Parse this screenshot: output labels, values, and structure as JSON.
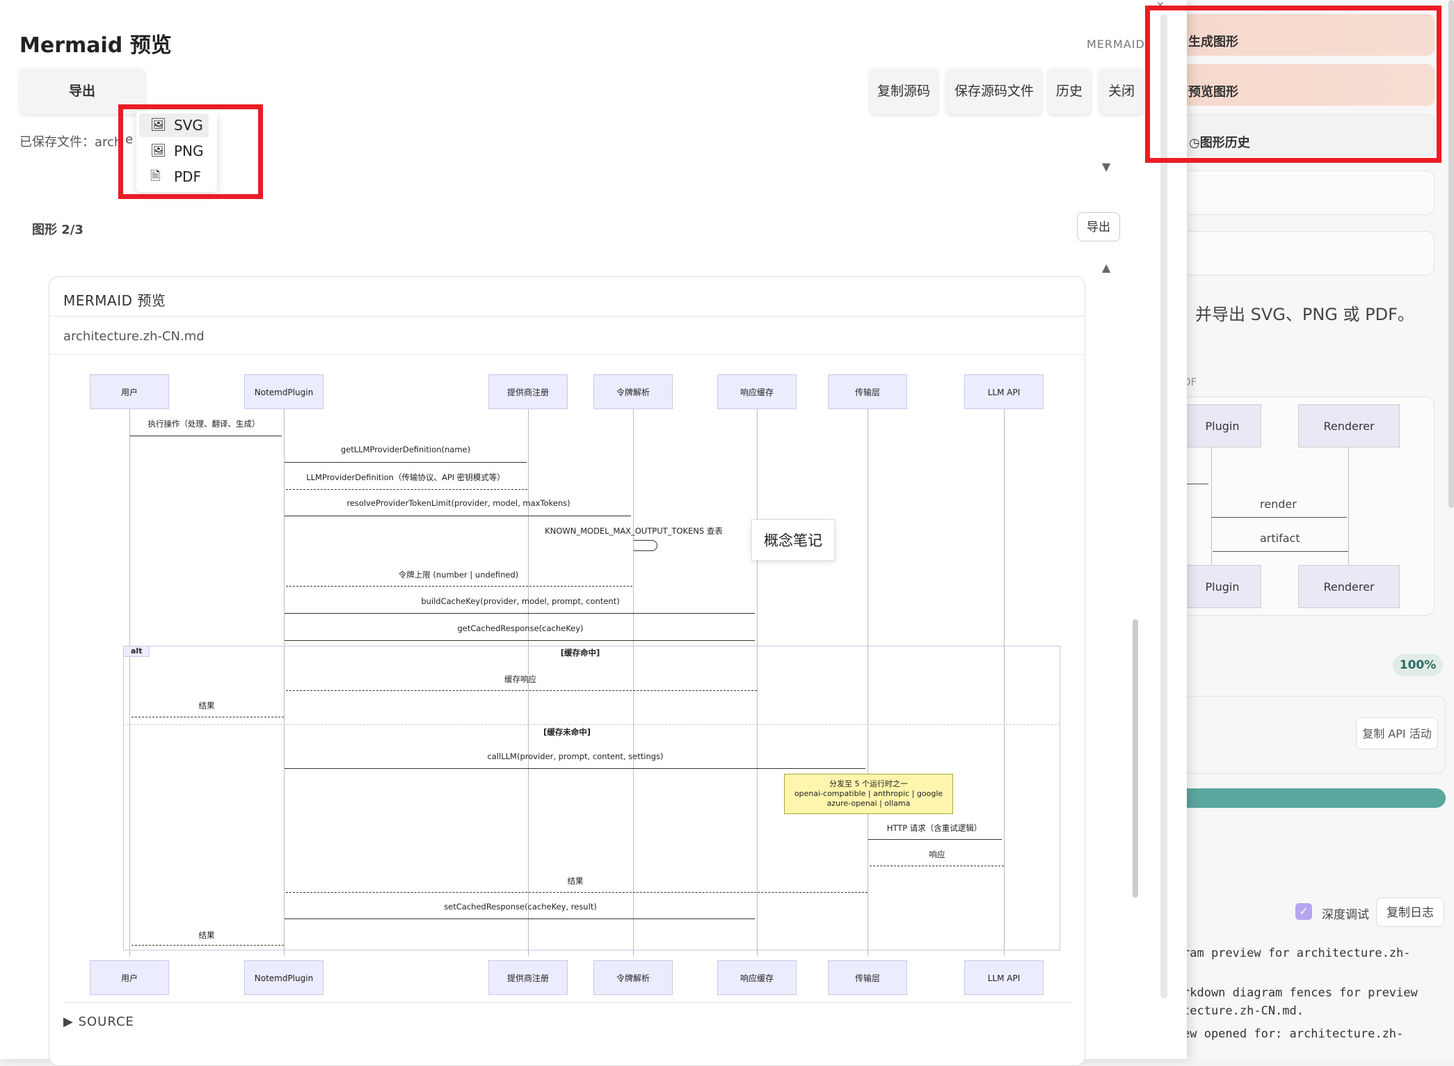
{
  "right_panel": {
    "generate_label": "生成图形",
    "preview_label": "预览图形",
    "history_label": "图形历史",
    "description": "并导出 SVG、PNG 或 PDF。",
    "format_hint": "DF",
    "diagram": {
      "actor_a_top": "Plugin",
      "actor_b_top": "Renderer",
      "msg_render": "render",
      "msg_artifact": "artifact",
      "actor_a_bottom": "Plugin",
      "actor_b_bottom": "Renderer"
    },
    "progress_pct": "100%",
    "copy_api_label": "复制 API 活动",
    "debug_label": "深度调试",
    "copy_log_label": "复制日志",
    "log_lines": [
      "ram preview for architecture.zh-",
      "rkdown diagram fences for preview",
      "tecture.zh-CN.md.",
      "ew opened for: architecture.zh-"
    ]
  },
  "modal": {
    "title": "Mermaid 预览",
    "tag": "MERMAID",
    "export_label": "导出",
    "copy_source_label": "复制源码",
    "save_source_label": "保存源码文件",
    "history_label": "历史",
    "close_label": "关闭",
    "saved_file_label": "已保存文件：arch",
    "saved_file_suffix": "e",
    "export_menu": [
      "SVG",
      "PNG",
      "PDF"
    ],
    "figure_label": "图形 2/3",
    "figure_export_label": "导出",
    "concept_note_label": "概念笔记"
  },
  "preview": {
    "header": "MERMAID 预览",
    "filename": "architecture.zh-CN.md",
    "source_toggle": "▶ SOURCE"
  },
  "sequence": {
    "actors": [
      "用户",
      "NotemdPlugin",
      "提供商注册",
      "令牌解析",
      "响应缓存",
      "传输层",
      "LLM API"
    ],
    "messages": [
      "执行操作（处理、翻译、生成）",
      "getLLMProviderDefinition(name)",
      "LLMProviderDefinition（传输协议、API 密钥模式等）",
      "resolveProviderTokenLimit(provider, model, maxTokens)",
      "KNOWN_MODEL_MAX_OUTPUT_TOKENS 查表",
      "令牌上限 (number | undefined)",
      "buildCacheKey(provider, model, prompt, content)",
      "getCachedResponse(cacheKey)",
      "缓存响应",
      "结果",
      "callLLM(provider, prompt, content, settings)",
      "HTTP 请求（含重试逻辑）",
      "响应",
      "结果",
      "setCachedResponse(cacheKey, result)",
      "结果"
    ],
    "alt_label": "alt",
    "alt_hit": "[缓存命中]",
    "alt_miss": "[缓存未命中]",
    "note_lines": [
      "分发至 5 个运行时之一",
      "openai-compatible | anthropic | google",
      "azure-openai | ollama"
    ]
  },
  "colors": {
    "accent_red": "#ea1c24",
    "actor_fill": "#ececff",
    "note_fill": "#fff5ad",
    "progress": "#5aa79e"
  }
}
